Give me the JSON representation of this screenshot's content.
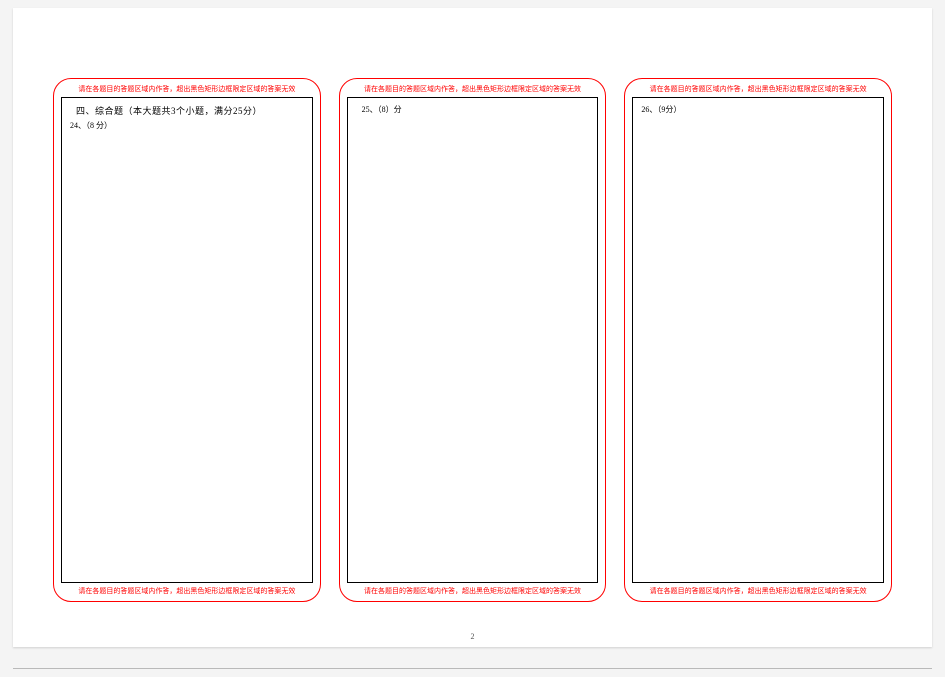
{
  "warning_text": "请在各题目的答题区域内作答，超出黑色矩形边框限定区域的答案无效",
  "section_heading": "四、综合题（本大题共3个小题，满分25分）",
  "panels": [
    {
      "question_label": "24、（8 分）"
    },
    {
      "question_label": "25、（8）分"
    },
    {
      "question_label": "26、（9分）"
    }
  ],
  "page_number": "2"
}
